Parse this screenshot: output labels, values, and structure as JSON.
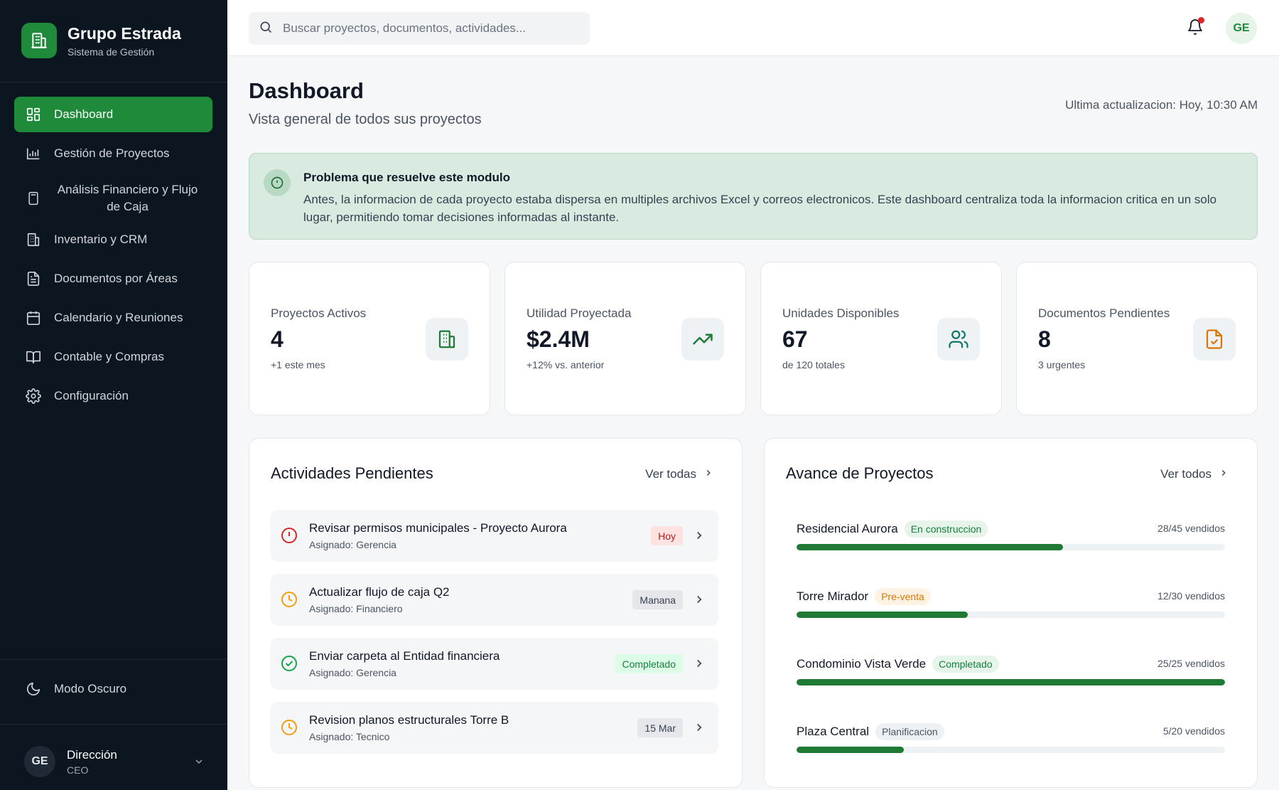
{
  "brand": {
    "name": "Grupo Estrada",
    "subtitle": "Sistema de Gestión",
    "color": "#1f8a3a"
  },
  "sidebar": {
    "items": [
      {
        "label": "Dashboard",
        "icon": "dashboard-icon",
        "active": true
      },
      {
        "label": "Gestión de Proyectos",
        "icon": "chart-icon"
      },
      {
        "label": "Análisis Financiero y Flujo de Caja",
        "icon": "calculator-icon"
      },
      {
        "label": "Inventario y CRM",
        "icon": "building-icon"
      },
      {
        "label": "Documentos por Áreas",
        "icon": "document-icon"
      },
      {
        "label": "Calendario y Reuniones",
        "icon": "calendar-icon"
      },
      {
        "label": "Contable y Compras",
        "icon": "book-icon"
      },
      {
        "label": "Configuración",
        "icon": "gear-icon"
      }
    ],
    "dark_mode_label": "Modo Oscuro",
    "user": {
      "initials": "GE",
      "name": "Dirección",
      "role": "CEO"
    }
  },
  "topbar": {
    "search_placeholder": "Buscar proyectos, documentos, actividades...",
    "avatar_initials": "GE"
  },
  "header": {
    "title": "Dashboard",
    "subtitle": "Vista general de todos sus proyectos",
    "last_update": "Ultima actualizacion: Hoy, 10:30 AM"
  },
  "info": {
    "title": "Problema que resuelve este modulo",
    "text": "Antes, la informacion de cada proyecto estaba dispersa en multiples archivos Excel y correos electronicos. Este dashboard centraliza toda la informacion critica en un solo lugar, permitiendo tomar decisiones informadas al instante."
  },
  "stats": [
    {
      "label": "Proyectos Activos",
      "value": "4",
      "note": "+1 este mes",
      "icon": "building-icon",
      "icon_color": "#1e7a35",
      "icon_bg": "#eef2f5"
    },
    {
      "label": "Utilidad Proyectada",
      "value": "$2.4M",
      "note": "+12% vs. anterior",
      "icon": "trending-up-icon",
      "icon_color": "#1e7a35",
      "icon_bg": "#eef2f5"
    },
    {
      "label": "Unidades Disponibles",
      "value": "67",
      "note": "de 120 totales",
      "icon": "users-icon",
      "icon_color": "#0f766e",
      "icon_bg": "#eef2f5"
    },
    {
      "label": "Documentos Pendientes",
      "value": "8",
      "note": "3 urgentes",
      "icon": "file-check-icon",
      "icon_color": "#d97706",
      "icon_bg": "#eef2f5"
    }
  ],
  "activities": {
    "title": "Actividades Pendientes",
    "link": "Ver todas",
    "items": [
      {
        "title": "Revisar permisos municipales - Proyecto Aurora",
        "assigned": "Asignado: Gerencia",
        "badge": "Hoy",
        "status": "urgent",
        "badge_color": "#b91c1c",
        "badge_bg": "#fde2e2",
        "icon_color": "#dc2626"
      },
      {
        "title": "Actualizar flujo de caja Q2",
        "assigned": "Asignado: Financiero",
        "badge": "Manana",
        "status": "pending",
        "badge_color": "#374151",
        "badge_bg": "#e5e7eb",
        "icon_color": "#f59e0b"
      },
      {
        "title": "Enviar carpeta al Entidad financiera",
        "assigned": "Asignado: Gerencia",
        "badge": "Completado",
        "status": "done",
        "badge_color": "#15803d",
        "badge_bg": "#dcfce7",
        "icon_color": "#16a34a"
      },
      {
        "title": "Revision planos estructurales Torre B",
        "assigned": "Asignado: Tecnico",
        "badge": "15 Mar",
        "status": "pending",
        "badge_color": "#374151",
        "badge_bg": "#e5e7eb",
        "icon_color": "#f59e0b"
      }
    ]
  },
  "projects": {
    "title": "Avance de Proyectos",
    "link": "Ver todos",
    "items": [
      {
        "name": "Residencial Aurora",
        "status": "En construccion",
        "status_color": "#15803d",
        "status_bg": "#e6f4ea",
        "sold": "28/45 vendidos",
        "progress": 0.622
      },
      {
        "name": "Torre Mirador",
        "status": "Pre-venta",
        "status_color": "#d97706",
        "status_bg": "#fef3e2",
        "sold": "12/30 vendidos",
        "progress": 0.4
      },
      {
        "name": "Condominio Vista Verde",
        "status": "Completado",
        "status_color": "#15803d",
        "status_bg": "#e6f4ea",
        "sold": "25/25 vendidos",
        "progress": 1.0
      },
      {
        "name": "Plaza Central",
        "status": "Planificacion",
        "status_color": "#4b5563",
        "status_bg": "#eef1f3",
        "sold": "5/20 vendidos",
        "progress": 0.25
      }
    ]
  }
}
